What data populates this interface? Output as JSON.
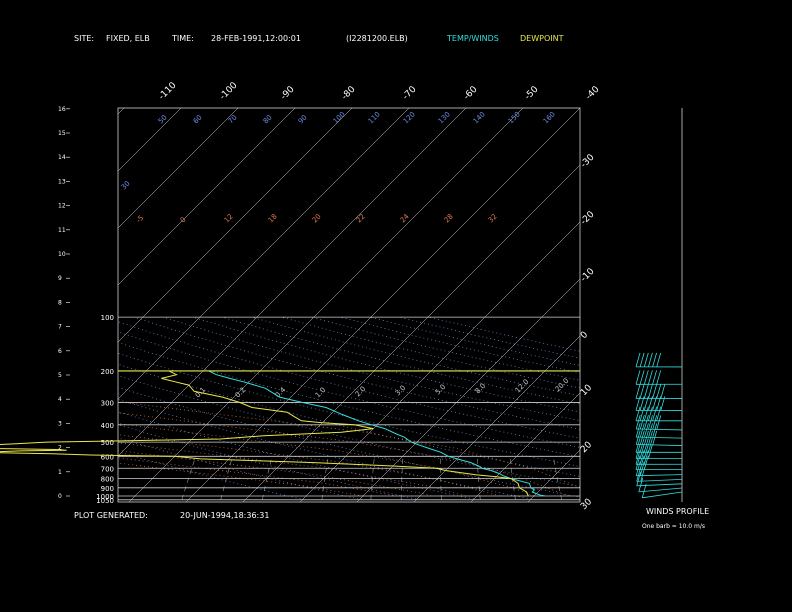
{
  "header": {
    "site_label": "SITE:",
    "site_value": "FIXED, ELB",
    "time_label": "TIME:",
    "time_value": "28-FEB-1991,12:00:01",
    "file_value": "(I2281200.ELB)",
    "legend_temp": "TEMP/WINDS",
    "legend_dew": "DEWPOINT"
  },
  "footer": {
    "generated_label": "PLOT GENERATED:",
    "generated_value": "20-JUN-1994,18:36:31",
    "winds_title": "WINDS PROFILE",
    "barb_note": "One barb = 10.0 m/s"
  },
  "colors": {
    "temp": "#33dddd",
    "dewpoint": "#e8e84a",
    "isotherm": "#ffffff",
    "dry_adiabat": "#6f8fe6",
    "moist_adiabat": "#e07b4f",
    "frame": "#d0d0d0"
  },
  "chart_data": {
    "type": "line",
    "title": "",
    "pressure_levels_hpa": [
      "100",
      "200",
      "300",
      "400",
      "500",
      "600",
      "700",
      "800",
      "900",
      "1000",
      "1050"
    ],
    "height_km_ticks": [
      "0",
      "1",
      "2",
      "3",
      "4",
      "5",
      "6",
      "7",
      "8",
      "9",
      "10",
      "11",
      "12",
      "13",
      "14",
      "15",
      "16"
    ],
    "isotherm_labels_top": [
      "-110",
      "-100",
      "-90",
      "-80",
      "-70",
      "-60",
      "-50",
      "-40"
    ],
    "isotherm_labels_right": [
      "-30",
      "-20",
      "-10",
      "0",
      "10",
      "20",
      "30"
    ],
    "isotherm_values_right": [
      -30,
      -20,
      -10,
      0,
      10,
      20,
      30
    ],
    "theta_labels": [
      "30",
      "50",
      "60",
      "70",
      "80",
      "90",
      "100",
      "110",
      "120",
      "130",
      "140",
      "150",
      "160"
    ],
    "mixing_labels": [
      "0.1",
      "0.2",
      "0.4",
      "1.0",
      "2.0",
      "3.0",
      "5.0",
      "8.0",
      "12.0",
      "20.0"
    ],
    "wet_bulb_labels": [
      "-5",
      "0",
      "12",
      "18",
      "20",
      "22",
      "24",
      "28",
      "32"
    ],
    "temperature_profile": {
      "name": "TEMP/WINDS",
      "pressure": [
        1000,
        990,
        970,
        950,
        925,
        900,
        850,
        800,
        770,
        750,
        720,
        700,
        680,
        650,
        620,
        600,
        570,
        550,
        520,
        500,
        470,
        450,
        420,
        400,
        380,
        350,
        320,
        300,
        280,
        250,
        230,
        220,
        210,
        200
      ],
      "temp_c": [
        22,
        21,
        20,
        19,
        19,
        18,
        17,
        13,
        11,
        10,
        8,
        6,
        5,
        3,
        0,
        -2,
        -4,
        -6,
        -9,
        -11,
        -13,
        -15,
        -18,
        -21,
        -24,
        -28,
        -32,
        -37,
        -42,
        -46,
        -51,
        -54,
        -57,
        -59
      ]
    },
    "dewpoint_profile": {
      "name": "DEWPOINT",
      "pressure": [
        1000,
        950,
        900,
        850,
        800,
        780,
        760,
        740,
        720,
        700,
        680,
        650,
        620,
        600,
        590,
        580,
        570,
        560,
        555,
        550,
        545,
        540,
        535,
        530,
        520,
        510,
        500,
        490,
        480,
        460,
        440,
        420,
        410,
        400,
        390,
        380,
        360,
        340,
        320,
        300,
        280,
        260,
        240,
        230,
        220,
        210,
        200
      ],
      "dewpoint_c": [
        19,
        18,
        16,
        15,
        13,
        10,
        6,
        3,
        0,
        -2,
        -10,
        -25,
        -45,
        -50,
        -65,
        -72,
        -85,
        -78,
        -70,
        -72,
        -80,
        -92,
        -95,
        -90,
        -85,
        -80,
        -75,
        -60,
        -45,
        -38,
        -25,
        -20,
        -22,
        -24,
        -30,
        -34,
        -36,
        -38,
        -45,
        -48,
        -52,
        -58,
        -60,
        -63,
        -66,
        -64,
        -66
      ]
    },
    "winds": {
      "pressure": [
        1000,
        950,
        900,
        850,
        800,
        750,
        700,
        650,
        600,
        550,
        500,
        450,
        400,
        350,
        300,
        250,
        200
      ],
      "speed_ms": [
        5,
        10,
        10,
        15,
        20,
        25,
        30,
        35,
        40,
        45,
        50,
        55,
        60,
        65,
        70,
        60,
        55
      ],
      "direction_deg": [
        240,
        250,
        260,
        260,
        265,
        270,
        270,
        270,
        270,
        275,
        275,
        275,
        270,
        270,
        270,
        270,
        270
      ]
    }
  }
}
